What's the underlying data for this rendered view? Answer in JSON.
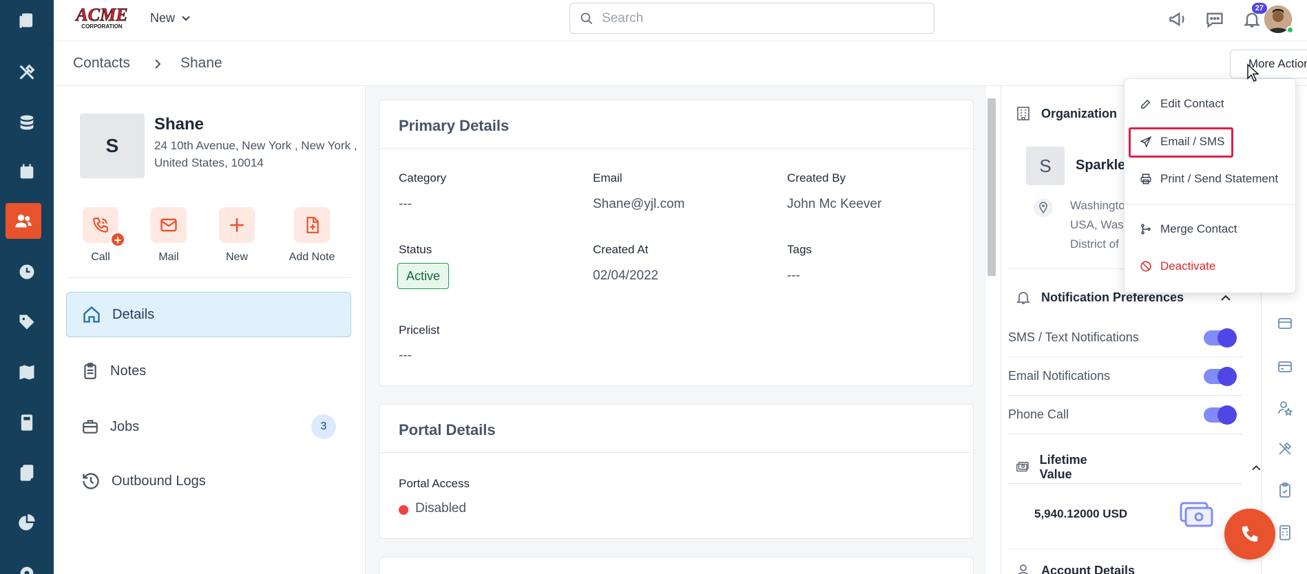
{
  "topbar": {
    "logo_text": "ACME",
    "logo_sub": "CORPORATION",
    "new_label": "New",
    "search_placeholder": "Search",
    "notification_count": "27"
  },
  "breadcrumb": {
    "root": "Contacts",
    "current": "Shane",
    "more_actions_label": "More Actions"
  },
  "contact": {
    "initial": "S",
    "name": "Shane",
    "address": "24 10th Avenue, New York , New York , United States, 10014"
  },
  "quick_actions": [
    {
      "label": "Call"
    },
    {
      "label": "Mail"
    },
    {
      "label": "New"
    },
    {
      "label": "Add Note"
    }
  ],
  "nav": [
    {
      "label": "Details"
    },
    {
      "label": "Notes"
    },
    {
      "label": "Jobs",
      "count": "3"
    },
    {
      "label": "Outbound Logs"
    }
  ],
  "primary_details": {
    "title": "Primary Details",
    "category_label": "Category",
    "category_value": "---",
    "email_label": "Email",
    "email_value": "Shane@yjl.com",
    "created_by_label": "Created By",
    "created_by_value": "John Mc Keever",
    "status_label": "Status",
    "status_value": "Active",
    "created_at_label": "Created At",
    "created_at_value": "02/04/2022",
    "tags_label": "Tags",
    "tags_value": "---",
    "pricelist_label": "Pricelist",
    "pricelist_value": "---"
  },
  "portal_details": {
    "title": "Portal Details",
    "access_label": "Portal Access",
    "access_value": "Disabled"
  },
  "right_panel": {
    "organization_label": "Organization",
    "org_initial": "S",
    "org_name": "Sparkle",
    "org_addr_line1": "Washingto",
    "org_addr_line2": "USA, Was",
    "org_addr_line3": "District of",
    "notification_prefs_label": "Notification Preferences",
    "sms_label": "SMS / Text Notifications",
    "email_notif_label": "Email Notifications",
    "phone_label": "Phone Call",
    "lifetime_label": "Lifetime Value",
    "lifetime_value": "5,940.12000 USD",
    "account_details_label": "Account Details"
  },
  "dropdown": {
    "items": [
      {
        "label": "Edit Contact"
      },
      {
        "label": "Email / SMS"
      },
      {
        "label": "Print / Send Statement"
      },
      {
        "label": "Merge Contact"
      },
      {
        "label": "Deactivate"
      }
    ]
  },
  "colors": {
    "rail_bg": "#153f5a",
    "accent": "#e8522c",
    "toggle_on": "#4f46e5",
    "active_nav_bg": "#e1f1fb"
  }
}
